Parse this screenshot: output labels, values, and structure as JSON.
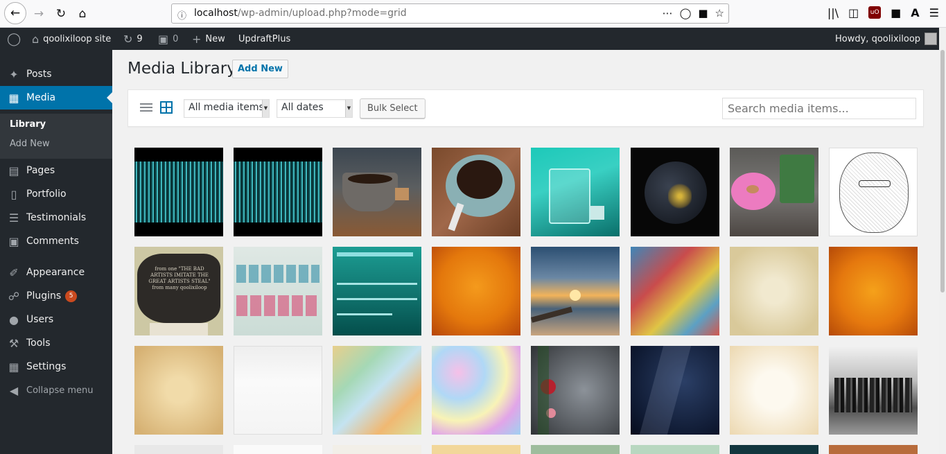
{
  "browser": {
    "url_host": "localhost",
    "url_path": "/wp-admin/upload.php?mode=grid"
  },
  "adminbar": {
    "site_name": "qoolixiloop site",
    "updates_count": "9",
    "comments_count": "0",
    "new_label": "New",
    "plugin_label": "UpdraftPlus",
    "howdy": "Howdy, qoolixiloop"
  },
  "sidebar": {
    "items": [
      {
        "label": "Posts",
        "icon": "pushpin-icon"
      },
      {
        "label": "Media",
        "icon": "media-icon"
      },
      {
        "label": "Pages",
        "icon": "pages-icon"
      },
      {
        "label": "Portfolio",
        "icon": "portfolio-icon"
      },
      {
        "label": "Testimonials",
        "icon": "testimonials-icon"
      },
      {
        "label": "Comments",
        "icon": "comments-icon"
      },
      {
        "label": "Appearance",
        "icon": "appearance-icon"
      },
      {
        "label": "Plugins",
        "icon": "plugins-icon",
        "badge": "5"
      },
      {
        "label": "Users",
        "icon": "users-icon"
      },
      {
        "label": "Tools",
        "icon": "tools-icon"
      },
      {
        "label": "Settings",
        "icon": "settings-icon"
      }
    ],
    "submenu": {
      "library": "Library",
      "add_new": "Add New"
    },
    "collapse": "Collapse menu"
  },
  "main": {
    "title": "Media Library",
    "add_new": "Add New",
    "filter_type": "All media items",
    "filter_date": "All dates",
    "bulk_select": "Bulk Select",
    "search_placeholder": "Search media items..."
  },
  "colors": {
    "admin_dark": "#23282d",
    "accent": "#0073aa",
    "badge": "#ca4a1f"
  },
  "media_grid": {
    "rows": [
      [
        "matrix-portrait-1",
        "matrix-portrait-2",
        "coffee-cup-sugar",
        "coffee-cup-spoon",
        "glass-water-splash",
        "planet-night-lights",
        "donut-and-mug",
        "sketch-portrait"
      ],
      [
        "stone-quote",
        "born-nobody-text",
        "highly-effective-text",
        "orange-texture-1",
        "beach-sunset",
        "colorful-abstract",
        "parchment-texture",
        "orange-texture-2"
      ],
      [
        "old-paper-texture",
        "white-texture",
        "pastel-paint",
        "watercolor-pastel",
        "roses-on-gray",
        "starry-sky",
        "cream-paper",
        "city-skyline-bw"
      ]
    ],
    "stone_quote_text": "from one \"THE BAD ARTISTS IMITATE THE GREAT ARTISTS STEAL\" from many qoolixiloop"
  }
}
